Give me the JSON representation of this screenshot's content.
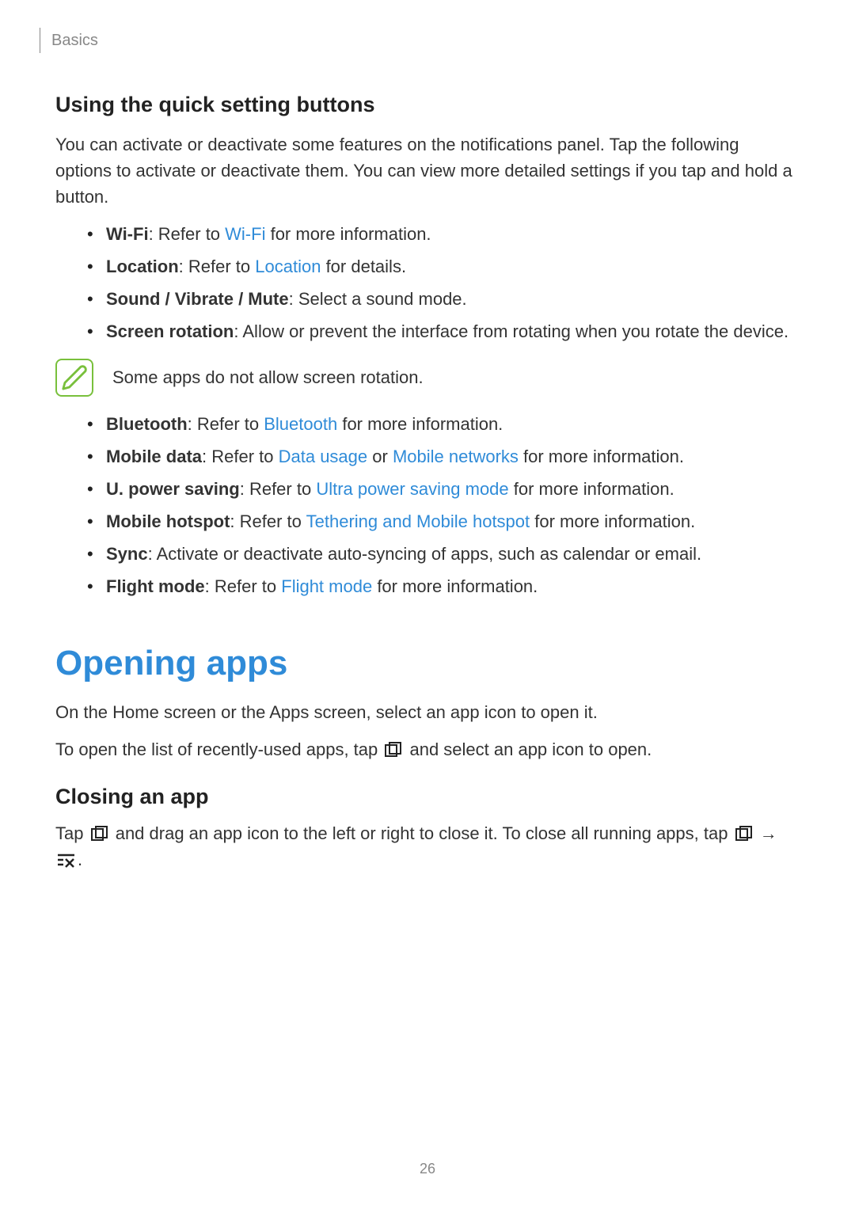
{
  "breadcrumb": "Basics",
  "section1": {
    "heading": "Using the quick setting buttons",
    "intro": "You can activate or deactivate some features on the notifications panel. Tap the following options to activate or deactivate them. You can view more detailed settings if you tap and hold a button.",
    "bullets_a": [
      {
        "bold": "Wi-Fi",
        "pre": ": Refer to ",
        "link": "Wi-Fi",
        "post": " for more information."
      },
      {
        "bold": "Location",
        "pre": ": Refer to ",
        "link": "Location",
        "post": " for details."
      },
      {
        "bold": "Sound / Vibrate / Mute",
        "pre": ": Select a sound mode.",
        "link": "",
        "post": ""
      },
      {
        "bold": "Screen rotation",
        "pre": ": Allow or prevent the interface from rotating when you rotate the device.",
        "link": "",
        "post": ""
      }
    ],
    "note": "Some apps do not allow screen rotation.",
    "bullets_b": {
      "bluetooth": {
        "bold": "Bluetooth",
        "pre": ": Refer to ",
        "link": "Bluetooth",
        "post": " for more information."
      },
      "mobiledata": {
        "bold": "Mobile data",
        "pre": ": Refer to ",
        "link1": "Data usage",
        "mid": " or ",
        "link2": "Mobile networks",
        "post": " for more information."
      },
      "upower": {
        "bold": "U. power saving",
        "pre": ": Refer to ",
        "link": "Ultra power saving mode",
        "post": " for more information."
      },
      "hotspot": {
        "bold": "Mobile hotspot",
        "pre": ": Refer to ",
        "link": "Tethering and Mobile hotspot",
        "post": " for more information."
      },
      "sync": {
        "bold": "Sync",
        "pre": ": Activate or deactivate auto-syncing of apps, such as calendar or email."
      },
      "flight": {
        "bold": "Flight mode",
        "pre": ": Refer to ",
        "link": "Flight mode",
        "post": " for more information."
      }
    }
  },
  "section2": {
    "heading": "Opening apps",
    "p1": "On the Home screen or the Apps screen, select an app icon to open it.",
    "p2_pre": "To open the list of recently-used apps, tap ",
    "p2_post": " and select an app icon to open.",
    "closing_heading": "Closing an app",
    "closing_p_part1": "Tap ",
    "closing_p_part2": " and drag an app icon to the left or right to close it. To close all running apps, tap ",
    "closing_p_part3": " → ",
    "closing_p_part4": "."
  },
  "page_number": "26"
}
